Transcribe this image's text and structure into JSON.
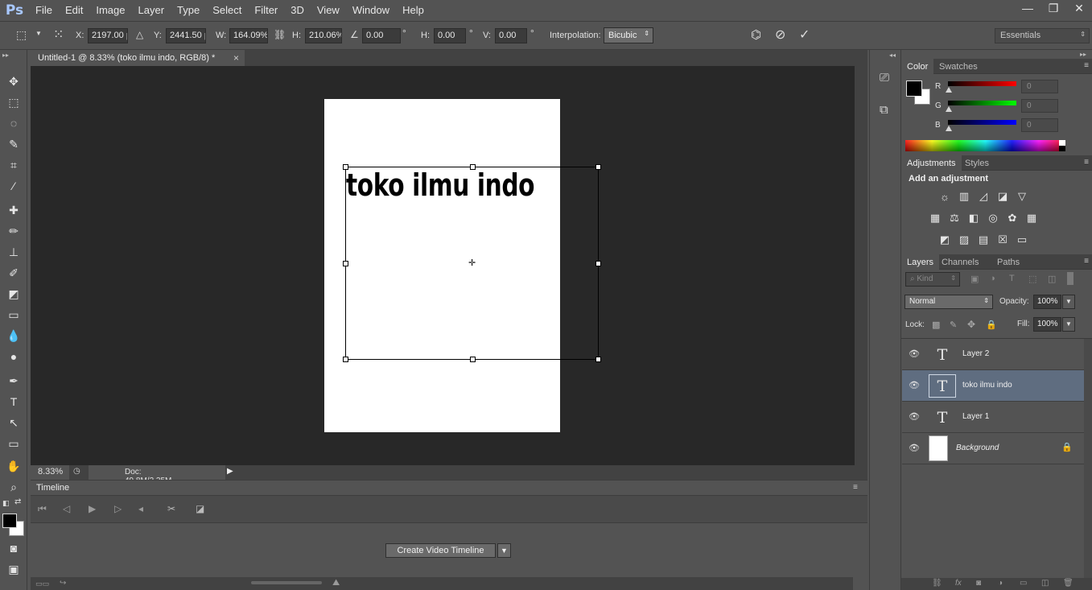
{
  "app": {
    "logo": "Ps"
  },
  "menu": [
    "File",
    "Edit",
    "Image",
    "Layer",
    "Type",
    "Select",
    "Filter",
    "3D",
    "View",
    "Window",
    "Help"
  ],
  "window_controls": {
    "minimize": "—",
    "restore": "❐",
    "close": "✕"
  },
  "options_bar": {
    "x_label": "X:",
    "x_value": "2197.00 px",
    "y_label": "Y:",
    "y_value": "2441.50 px",
    "w_label": "W:",
    "w_value": "164.09%",
    "h_label": "H:",
    "h_value": "210.06%",
    "angle_value": "0.00",
    "hskew_label": "H:",
    "hskew_value": "0.00",
    "vskew_label": "V:",
    "vskew_value": "0.00",
    "degree": "°",
    "interpolation_label": "Interpolation:",
    "interpolation_value": "Bicubic",
    "workspace": "Essentials"
  },
  "document": {
    "tab_title": "Untitled-1 @ 8.33% (toko ilmu indo, RGB/8) *",
    "close": "×",
    "canvas_text": "toko ilmu indo",
    "zoom": "8.33%",
    "doc_size": "Doc: 49.8M/2.25M"
  },
  "timeline": {
    "tab": "Timeline",
    "create_button": "Create Video Timeline"
  },
  "color_panel": {
    "tabs": [
      "Color",
      "Swatches"
    ],
    "r_label": "R",
    "g_label": "G",
    "b_label": "B",
    "r_value": "0",
    "g_value": "0",
    "b_value": "0",
    "colors": {
      "red": "#ff0000",
      "green": "#00ff00",
      "blue": "#0000ff"
    }
  },
  "adjustments_panel": {
    "tabs": [
      "Adjustments",
      "Styles"
    ],
    "heading": "Add an adjustment"
  },
  "layers_panel": {
    "tabs": [
      "Layers",
      "Channels",
      "Paths"
    ],
    "filter_kind": "Kind",
    "blend_mode": "Normal",
    "opacity_label": "Opacity:",
    "opacity_value": "100%",
    "lock_label": "Lock:",
    "fill_label": "Fill:",
    "fill_value": "100%",
    "layers": [
      {
        "name": "Layer 2",
        "type": "text",
        "selected": false
      },
      {
        "name": "toko ilmu indo",
        "type": "text",
        "selected": true
      },
      {
        "name": "Layer 1",
        "type": "text",
        "selected": false
      },
      {
        "name": "Background",
        "type": "image",
        "selected": false,
        "locked": true
      }
    ]
  }
}
